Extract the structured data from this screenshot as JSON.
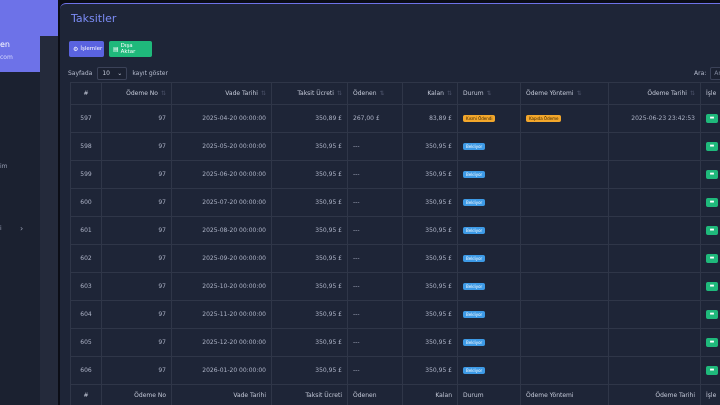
{
  "sidebar": {
    "user_name": "en",
    "user_sub": "com",
    "item_a": "im",
    "item_b": "i"
  },
  "page": {
    "title": "Taksitler",
    "actions_label": "İşlemler",
    "export_label": "Dışa Aktar",
    "length_prefix": "Sayfada",
    "length_value": "10",
    "length_suffix": "kayıt göster",
    "search_label": "Ara:",
    "search_placeholder": "Ar"
  },
  "table": {
    "columns": [
      "#",
      "Ödeme No",
      "Vade Tarihi",
      "Taksit Ücreti",
      "Ödenen",
      "Kalan",
      "Durum",
      "Ödeme Yöntemi",
      "Ödeme Tarihi",
      "İşle"
    ],
    "footer": [
      "#",
      "Ödeme No",
      "Vade Tarihi",
      "Taksit Ücreti",
      "Ödenen",
      "Kalan",
      "Durum",
      "Ödeme Yöntemi",
      "Ödeme Tarihi",
      "İşle"
    ],
    "rows": [
      {
        "id": "597",
        "payment_no": "97",
        "due": "2025-04-20 00:00:00",
        "amount": "350,89 £",
        "paid": "267,00 £",
        "remaining": "83,89 £",
        "status": "Kısmi Ödendi",
        "status_type": "warn",
        "method": "Kapıda Ödeme",
        "method_type": "warn",
        "pay_date": "2025-06-23 23:42:53"
      },
      {
        "id": "598",
        "payment_no": "97",
        "due": "2025-05-20 00:00:00",
        "amount": "350,95 £",
        "paid": "---",
        "remaining": "350,95 £",
        "status": "Bekliyor",
        "status_type": "info",
        "method": "",
        "method_type": "",
        "pay_date": ""
      },
      {
        "id": "599",
        "payment_no": "97",
        "due": "2025-06-20 00:00:00",
        "amount": "350,95 £",
        "paid": "---",
        "remaining": "350,95 £",
        "status": "Bekliyor",
        "status_type": "info",
        "method": "",
        "method_type": "",
        "pay_date": ""
      },
      {
        "id": "600",
        "payment_no": "97",
        "due": "2025-07-20 00:00:00",
        "amount": "350,95 £",
        "paid": "---",
        "remaining": "350,95 £",
        "status": "Bekliyor",
        "status_type": "info",
        "method": "",
        "method_type": "",
        "pay_date": ""
      },
      {
        "id": "601",
        "payment_no": "97",
        "due": "2025-08-20 00:00:00",
        "amount": "350,95 £",
        "paid": "---",
        "remaining": "350,95 £",
        "status": "Bekliyor",
        "status_type": "info",
        "method": "",
        "method_type": "",
        "pay_date": ""
      },
      {
        "id": "602",
        "payment_no": "97",
        "due": "2025-09-20 00:00:00",
        "amount": "350,95 £",
        "paid": "---",
        "remaining": "350,95 £",
        "status": "Bekliyor",
        "status_type": "info",
        "method": "",
        "method_type": "",
        "pay_date": ""
      },
      {
        "id": "603",
        "payment_no": "97",
        "due": "2025-10-20 00:00:00",
        "amount": "350,95 £",
        "paid": "---",
        "remaining": "350,95 £",
        "status": "Bekliyor",
        "status_type": "info",
        "method": "",
        "method_type": "",
        "pay_date": ""
      },
      {
        "id": "604",
        "payment_no": "97",
        "due": "2025-11-20 00:00:00",
        "amount": "350,95 £",
        "paid": "---",
        "remaining": "350,95 £",
        "status": "Bekliyor",
        "status_type": "info",
        "method": "",
        "method_type": "",
        "pay_date": ""
      },
      {
        "id": "605",
        "payment_no": "97",
        "due": "2025-12-20 00:00:00",
        "amount": "350,95 £",
        "paid": "---",
        "remaining": "350,95 £",
        "status": "Bekliyor",
        "status_type": "info",
        "method": "",
        "method_type": "",
        "pay_date": ""
      },
      {
        "id": "606",
        "payment_no": "97",
        "due": "2026-01-20 00:00:00",
        "amount": "350,95 £",
        "paid": "---",
        "remaining": "350,95 £",
        "status": "Bekliyor",
        "status_type": "info",
        "method": "",
        "method_type": "",
        "pay_date": ""
      }
    ]
  },
  "colors": {
    "accent": "#6d72e8",
    "success": "#1fb97b",
    "info": "#3d9ae6",
    "warning": "#f3a72b",
    "panel": "#1e2537"
  }
}
